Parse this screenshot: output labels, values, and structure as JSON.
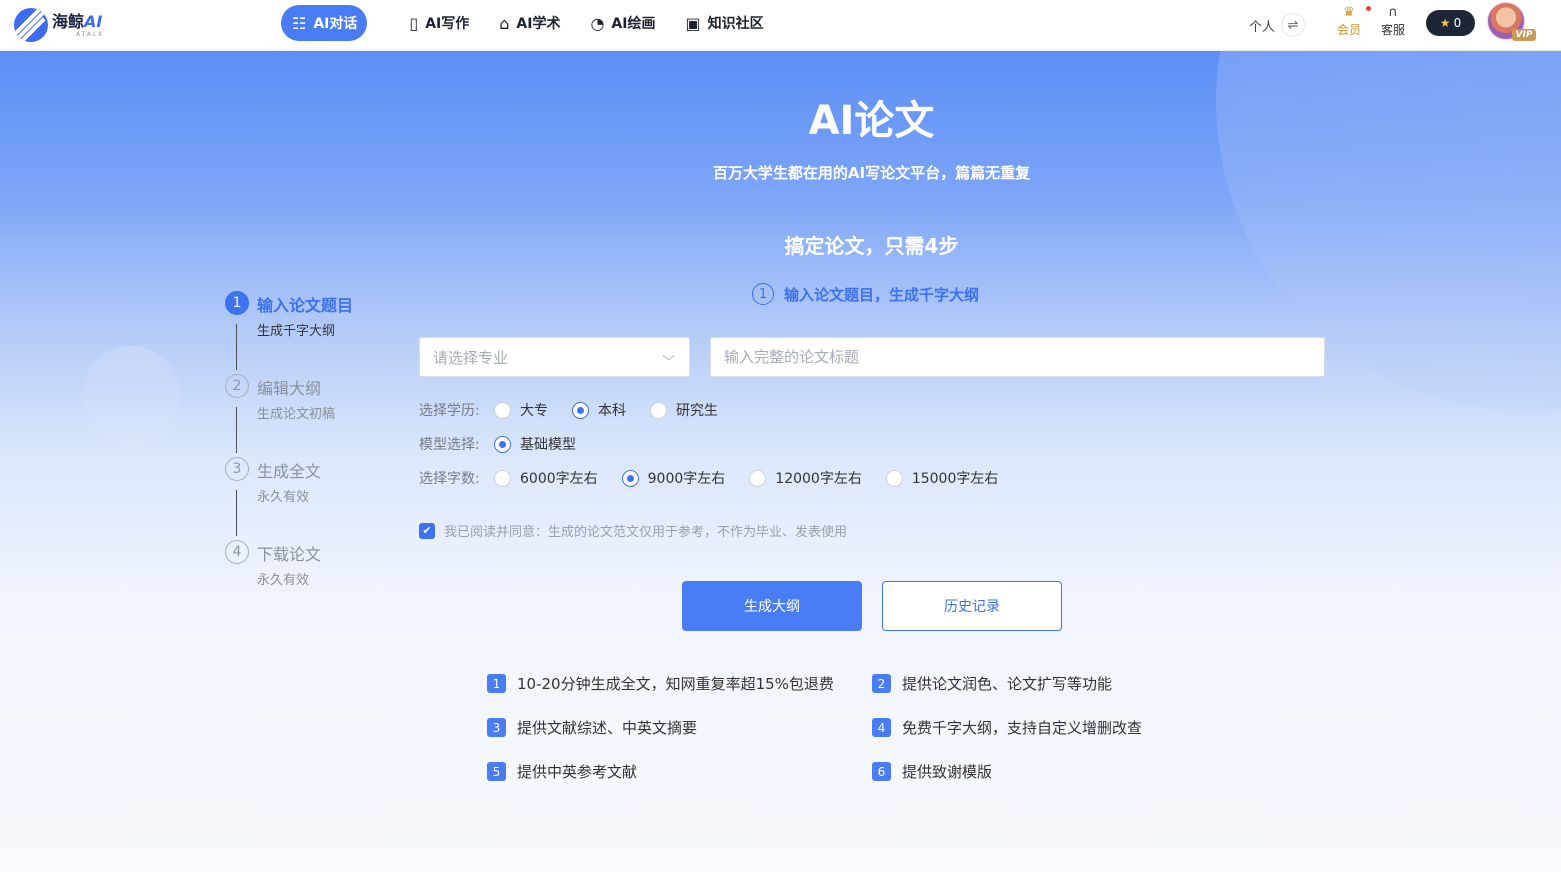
{
  "brand": {
    "name": "海鲸",
    "suffix": "AI",
    "tagline": "ATALK"
  },
  "nav": [
    {
      "label": "AI对话",
      "icon": "chat-bubble-icon"
    },
    {
      "label": "AI写作",
      "icon": "notebook-icon"
    },
    {
      "label": "AI学术",
      "icon": "graduation-cap-icon"
    },
    {
      "label": "AI绘画",
      "icon": "palette-icon"
    },
    {
      "label": "知识社区",
      "icon": "book-icon"
    }
  ],
  "header": {
    "personal_label": "个人",
    "member_label": "会员",
    "service_label": "客服",
    "points": "0",
    "vip_badge": "VIP"
  },
  "hero": {
    "title": "AI论文",
    "subtitle": "百万大学生都在用的AI写论文平台，篇篇无重复",
    "steps_title": "搞定论文，只需4步",
    "current_step_num": "1",
    "current_step_text": "输入论文题目，生成千字大纲"
  },
  "stepper": [
    {
      "num": "1",
      "label": "输入论文题目",
      "desc": "生成千字大纲",
      "active": true
    },
    {
      "num": "2",
      "label": "编辑大纲",
      "desc": "生成论文初稿",
      "active": false
    },
    {
      "num": "3",
      "label": "生成全文",
      "desc": "永久有效",
      "active": false
    },
    {
      "num": "4",
      "label": "下载论文",
      "desc": "永久有效",
      "active": false
    }
  ],
  "form": {
    "major_placeholder": "请选择专业",
    "title_placeholder": "输入完整的论文标题",
    "education": {
      "label": "选择学历:",
      "options": [
        "大专",
        "本科",
        "研究生"
      ],
      "selected": "本科"
    },
    "model": {
      "label": "模型选择:",
      "options": [
        "基础模型"
      ],
      "selected": "基础模型"
    },
    "word_count": {
      "label": "选择字数:",
      "options": [
        "6000字左右",
        "9000字左右",
        "12000字左右",
        "15000字左右"
      ],
      "selected": "9000字左右"
    },
    "agree_text": "我已阅读并同意：生成的论文范文仅用于参考，不作为毕业、发表使用",
    "agree_checked": true,
    "generate_label": "生成大纲",
    "history_label": "历史记录"
  },
  "features": [
    {
      "num": "1",
      "text": "10-20分钟生成全文，知网重复率超15%包退费"
    },
    {
      "num": "2",
      "text": "提供论文润色、论文扩写等功能"
    },
    {
      "num": "3",
      "text": "提供文献综述、中英文摘要"
    },
    {
      "num": "4",
      "text": "免费千字大纲，支持自定义增删改查"
    },
    {
      "num": "5",
      "text": "提供中英参考文献"
    },
    {
      "num": "6",
      "text": "提供致谢模版"
    }
  ],
  "colors": {
    "accent": "#4a7df5",
    "accent_dark": "#3d72f0",
    "topbar": "#ffffff",
    "points_bg": "#1e2537",
    "vip_gold": "#c89b5a"
  }
}
